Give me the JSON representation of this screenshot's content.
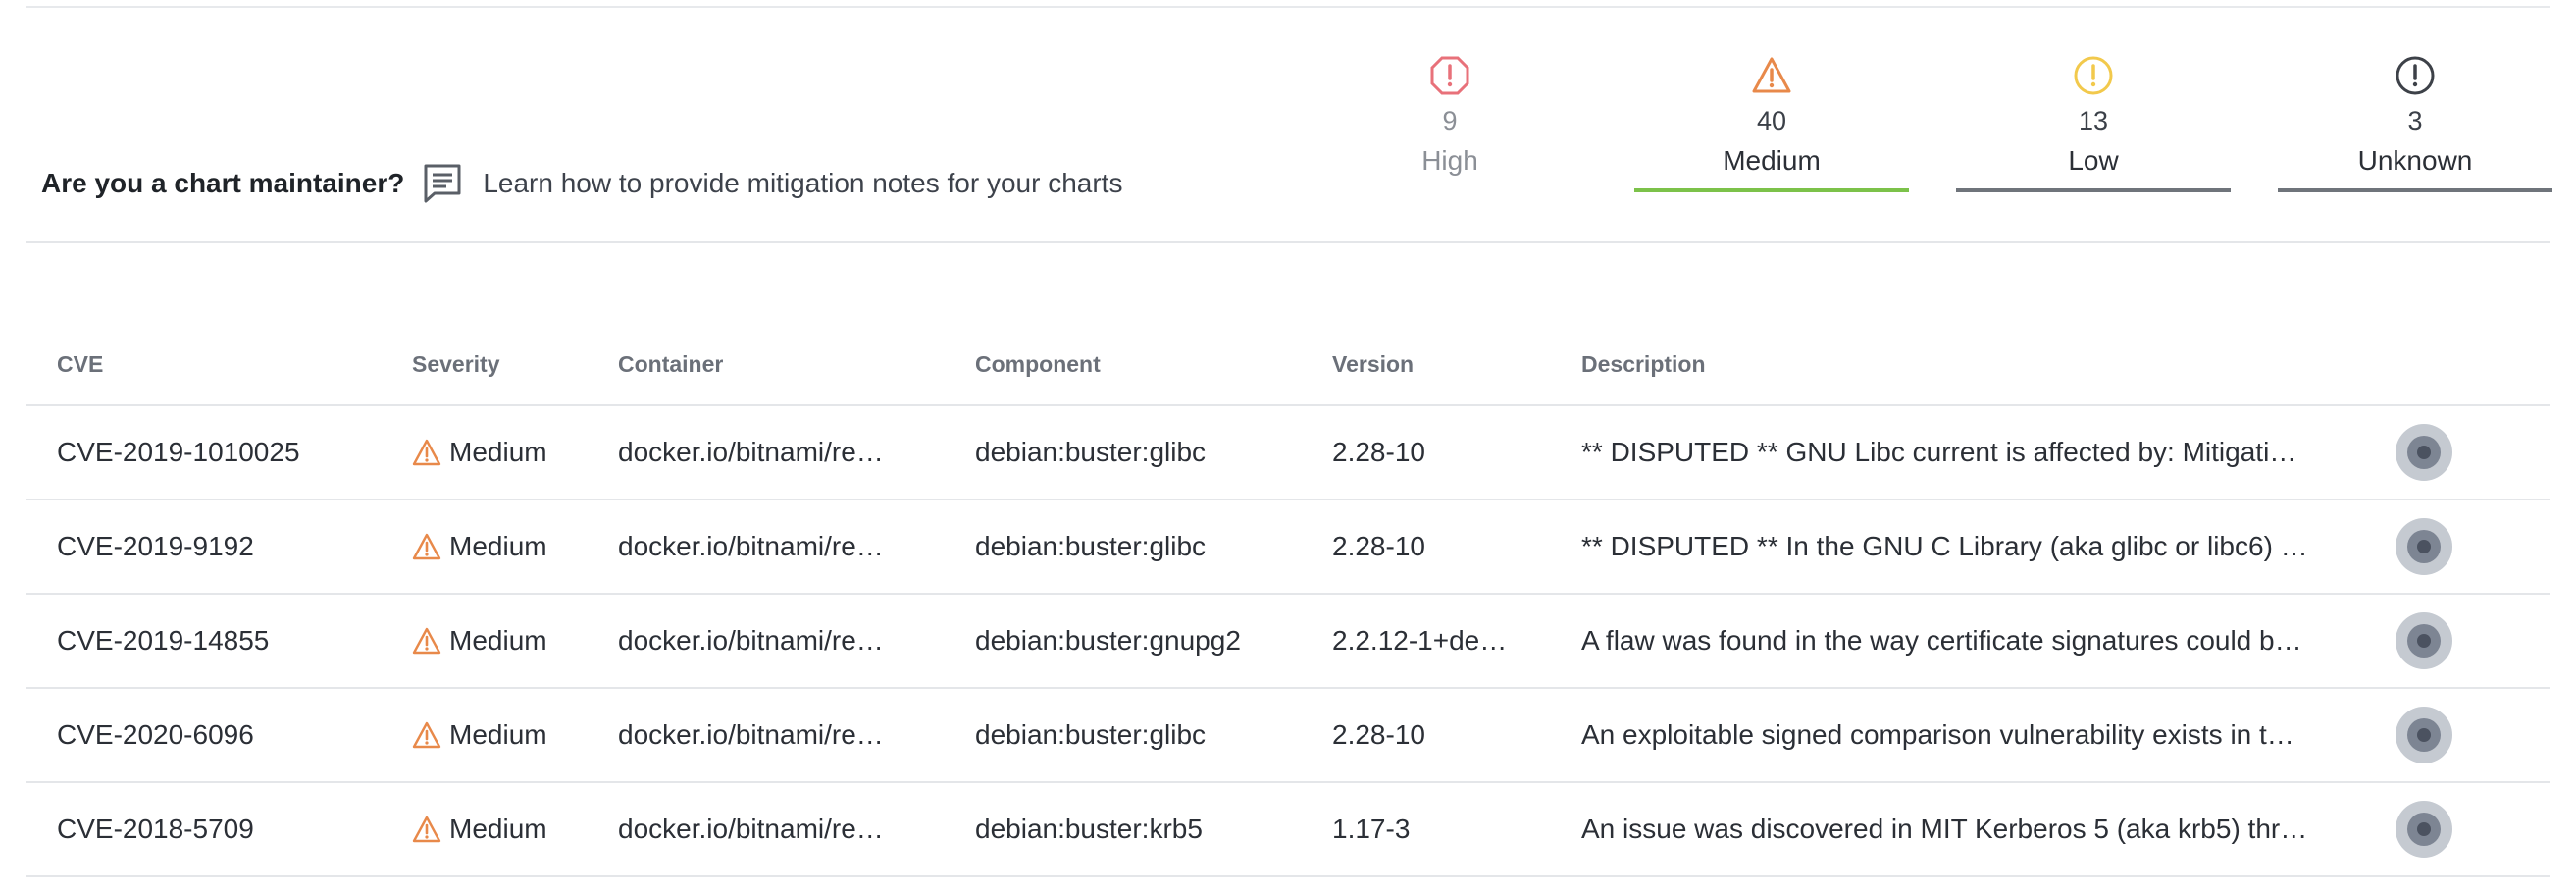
{
  "maintainer": {
    "question": "Are you a chart maintainer?",
    "link_text": "Learn how to provide mitigation notes for your charts",
    "icon": "comment-icon"
  },
  "severity_tabs": [
    {
      "count": "9",
      "label": "High",
      "icon": "octagon-exclamation-icon",
      "color": "#e8717a",
      "selected": false
    },
    {
      "count": "40",
      "label": "Medium",
      "icon": "triangle-exclamation-icon",
      "color": "#e8894a",
      "selected": true,
      "underline": "#7cc24a"
    },
    {
      "count": "13",
      "label": "Low",
      "icon": "circle-exclamation-icon",
      "color": "#f2c94c",
      "selected": false,
      "underline": "#6f747b"
    },
    {
      "count": "3",
      "label": "Unknown",
      "icon": "circle-exclamation-icon",
      "color": "#3d4148",
      "selected": false,
      "underline": "#6f747b"
    }
  ],
  "table": {
    "columns": [
      "CVE",
      "Severity",
      "Container",
      "Component",
      "Version",
      "Description"
    ],
    "rows": [
      {
        "cve": "CVE-2019-1010025",
        "severity": "Medium",
        "container": "docker.io/bitnami/re…",
        "component": "debian:buster:glibc",
        "version": "2.28-10",
        "description": "** DISPUTED ** GNU Libc current is affected by: Mitigati…"
      },
      {
        "cve": "CVE-2019-9192",
        "severity": "Medium",
        "container": "docker.io/bitnami/re…",
        "component": "debian:buster:glibc",
        "version": "2.28-10",
        "description": "** DISPUTED ** In the GNU C Library (aka glibc or libc6) …"
      },
      {
        "cve": "CVE-2019-14855",
        "severity": "Medium",
        "container": "docker.io/bitnami/re…",
        "component": "debian:buster:gnupg2",
        "version": "2.2.12-1+de…",
        "description": "A flaw was found in the way certificate signatures could b…"
      },
      {
        "cve": "CVE-2020-6096",
        "severity": "Medium",
        "container": "docker.io/bitnami/re…",
        "component": "debian:buster:glibc",
        "version": "2.28-10",
        "description": "An exploitable signed comparison vulnerability exists in t…"
      },
      {
        "cve": "CVE-2018-5709",
        "severity": "Medium",
        "container": "docker.io/bitnami/re…",
        "component": "debian:buster:krb5",
        "version": "1.17-3",
        "description": "An issue was discovered in MIT Kerberos 5 (aka krb5) thr…"
      }
    ]
  },
  "colors": {
    "medium_warning": "#e8894a",
    "selected_underline": "#7cc24a"
  }
}
